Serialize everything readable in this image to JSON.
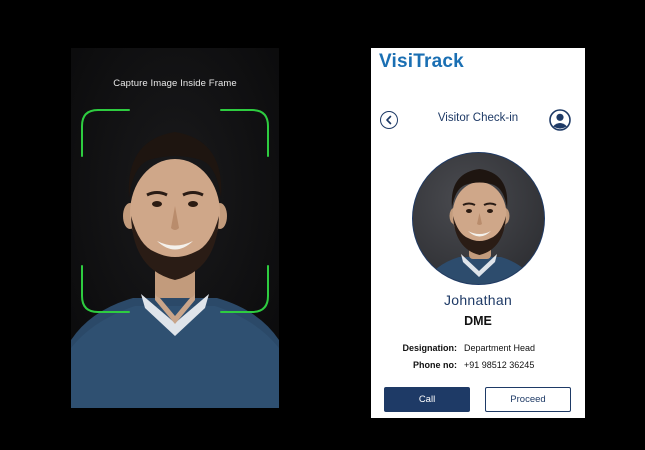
{
  "capture_screen": {
    "instruction": "Capture Image Inside Frame",
    "frame_color": "#2ecc40"
  },
  "checkin": {
    "brand": "VisiTrack",
    "title": "Visitor Check-in",
    "back_icon": "chevron-left-icon",
    "profile_icon": "user-circle-icon",
    "visitor": {
      "name": "Johnathan",
      "department": "DME",
      "designation_label": "Designation:",
      "designation_value": "Department Head",
      "phone_label": "Phone no:",
      "phone_value": "+91 98512 36245"
    },
    "buttons": {
      "call": "Call",
      "proceed": "Proceed"
    },
    "colors": {
      "brand": "#1a6fb3",
      "primary": "#1e3a66"
    }
  }
}
